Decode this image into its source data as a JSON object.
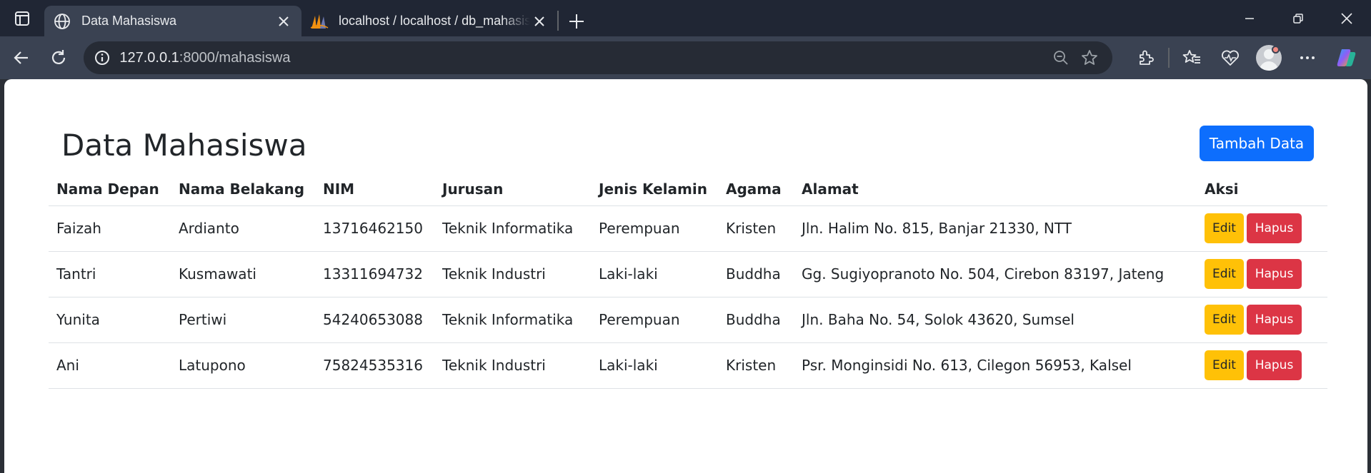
{
  "browser": {
    "tabs": [
      {
        "title": "Data Mahasiswa",
        "favicon": "globe-icon",
        "active": true
      },
      {
        "title": "localhost / localhost / db_mahasiswa",
        "favicon": "phpmyadmin-icon",
        "active": false
      }
    ],
    "address_host": "127.0.0.1",
    "address_path": ":8000/mahasiswa"
  },
  "page": {
    "title": "Data Mahasiswa",
    "add_button": "Tambah Data",
    "table": {
      "headers": [
        "Nama Depan",
        "Nama Belakang",
        "NIM",
        "Jurusan",
        "Jenis Kelamin",
        "Agama",
        "Alamat",
        "Aksi"
      ],
      "rows": [
        {
          "nama_depan": "Faizah",
          "nama_belakang": "Ardianto",
          "nim": "13716462150",
          "jurusan": "Teknik Informatika",
          "jenis_kelamin": "Perempuan",
          "agama": "Kristen",
          "alamat": "Jln. Halim No. 815, Banjar 21330, NTT"
        },
        {
          "nama_depan": "Tantri",
          "nama_belakang": "Kusmawati",
          "nim": "13311694732",
          "jurusan": "Teknik Industri",
          "jenis_kelamin": "Laki-laki",
          "agama": "Buddha",
          "alamat": "Gg. Sugiyopranoto No. 504, Cirebon 83197, Jateng"
        },
        {
          "nama_depan": "Yunita",
          "nama_belakang": "Pertiwi",
          "nim": "54240653088",
          "jurusan": "Teknik Informatika",
          "jenis_kelamin": "Perempuan",
          "agama": "Buddha",
          "alamat": "Jln. Baha No. 54, Solok 43620, Sumsel"
        },
        {
          "nama_depan": "Ani",
          "nama_belakang": "Latupono",
          "nim": "75824535316",
          "jurusan": "Teknik Industri",
          "jenis_kelamin": "Laki-laki",
          "agama": "Kristen",
          "alamat": "Psr. Monginsidi No. 613, Cilegon 56953, Kalsel"
        }
      ],
      "edit_label": "Edit",
      "delete_label": "Hapus"
    }
  },
  "colors": {
    "primary": "#0d6efd",
    "warning": "#ffc107",
    "danger": "#dc3545"
  }
}
